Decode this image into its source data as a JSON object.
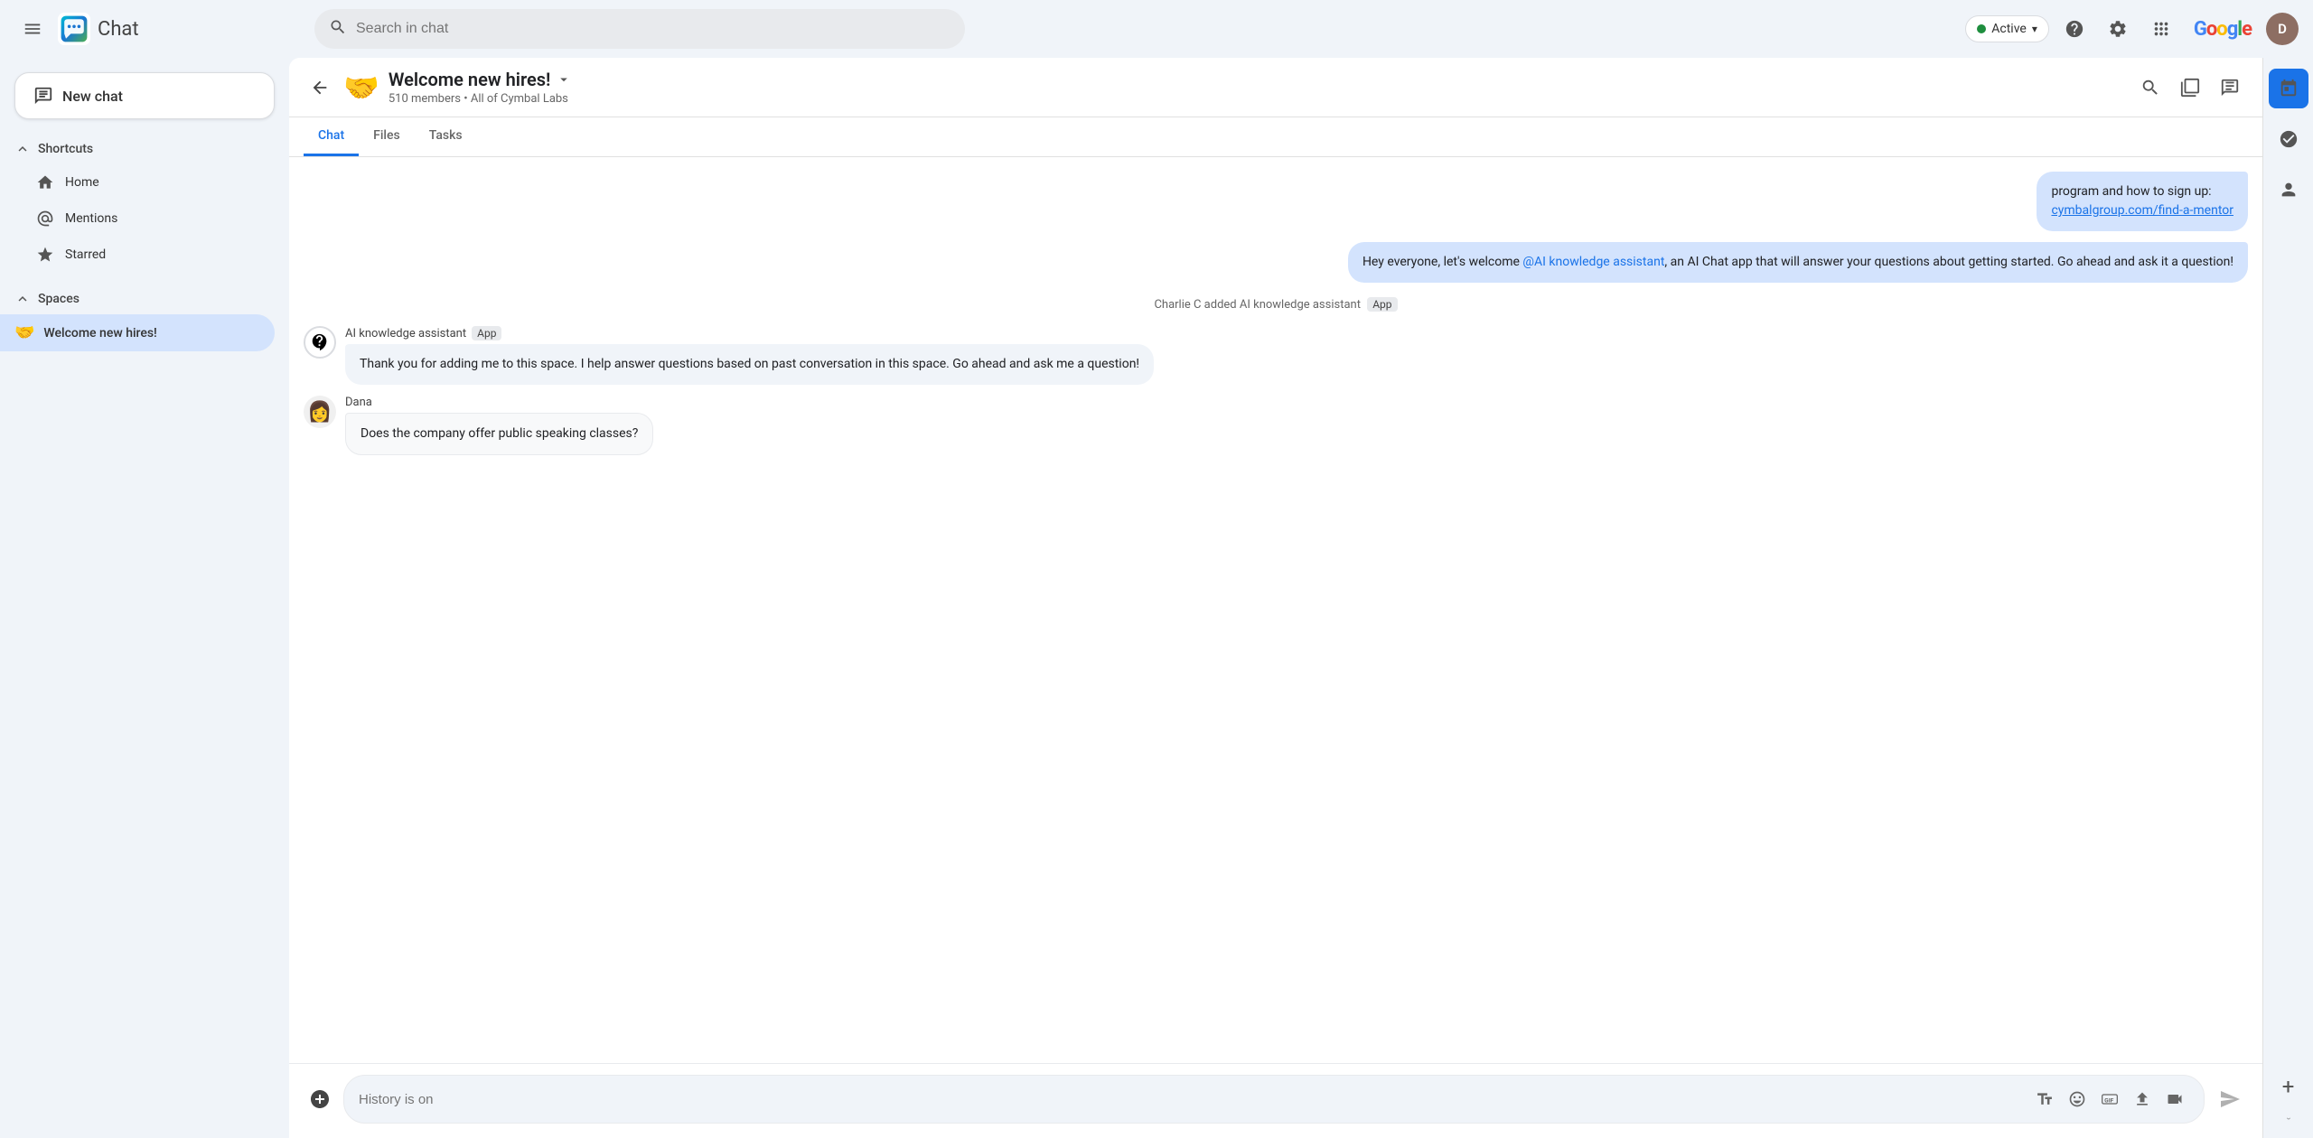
{
  "header": {
    "menu_icon": "hamburger-icon",
    "app_name": "Chat",
    "search_placeholder": "Search in chat",
    "status": {
      "label": "Active",
      "color": "#1e8e3e"
    },
    "google_logo": "Google",
    "avatar_initial": "D"
  },
  "sidebar": {
    "new_chat_label": "New chat",
    "shortcuts": {
      "label": "Shortcuts",
      "items": [
        {
          "id": "home",
          "label": "Home"
        },
        {
          "id": "mentions",
          "label": "Mentions"
        },
        {
          "id": "starred",
          "label": "Starred"
        }
      ]
    },
    "spaces": {
      "label": "Spaces",
      "items": [
        {
          "id": "welcome-new-hires",
          "label": "Welcome new hires!",
          "emoji": "🤝",
          "active": true
        }
      ]
    }
  },
  "chat": {
    "title": "Welcome new hires!",
    "members": "510 members",
    "org": "All of Cymbal Labs",
    "tabs": [
      {
        "id": "chat",
        "label": "Chat",
        "active": true
      },
      {
        "id": "files",
        "label": "Files",
        "active": false
      },
      {
        "id": "tasks",
        "label": "Tasks",
        "active": false
      }
    ],
    "messages": [
      {
        "id": "msg1",
        "type": "bubble-right",
        "text": "program and how to sign up:",
        "link": "cymbalgroup.com/find-a-mentor",
        "link_href": "cymbalgroup.com/find-a-mentor"
      },
      {
        "id": "msg2",
        "type": "bubble-right",
        "text": "Hey everyone, let's welcome @AI knowledge assistant, an AI Chat app that will answer your questions about getting started.  Go ahead and ask it a question!"
      },
      {
        "id": "msg3",
        "type": "system",
        "text": "Charlie C added AI knowledge assistant",
        "badge": "App"
      },
      {
        "id": "msg4",
        "type": "bot",
        "sender": "AI knowledge assistant",
        "badge": "App",
        "bot_icon": "❓",
        "text": "Thank you for adding me to this space. I help answer questions based on past conversation in this space. Go ahead and ask me a question!"
      },
      {
        "id": "msg5",
        "type": "user",
        "sender": "Dana",
        "avatar": "👩",
        "text": "Does the company offer public speaking classes?"
      }
    ],
    "input_placeholder": "History is on"
  },
  "right_sidebar": {
    "icons": [
      {
        "id": "calendar",
        "label": "Calendar"
      },
      {
        "id": "tasks",
        "label": "Tasks"
      },
      {
        "id": "contacts",
        "label": "Contacts"
      }
    ]
  }
}
